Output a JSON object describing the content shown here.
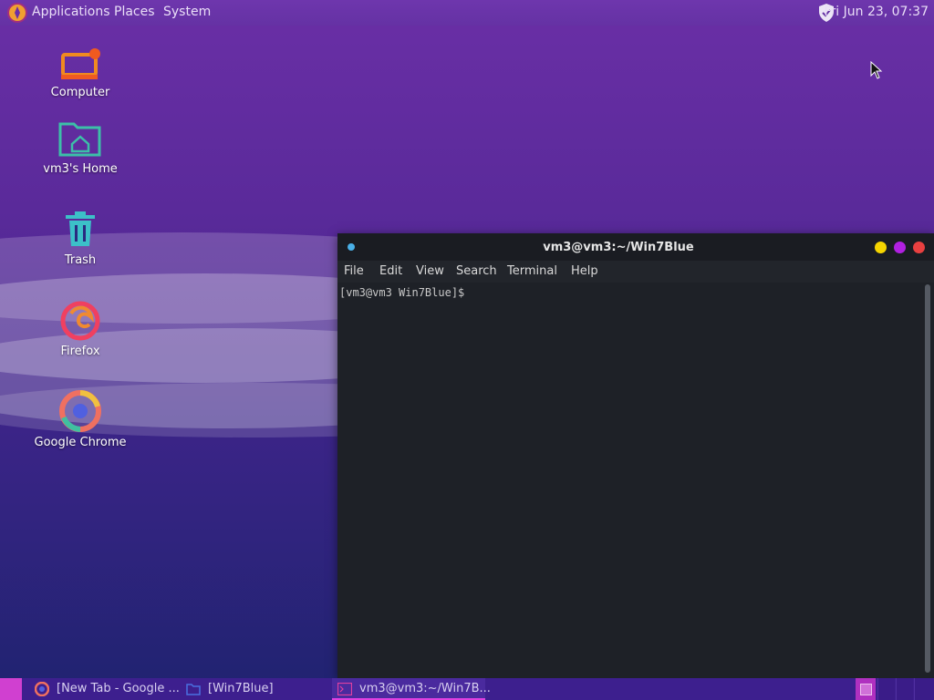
{
  "top_panel": {
    "applications_label": "Applications",
    "places_label": "Places",
    "system_label": "System",
    "clock": "Fri Jun 23, 07:37"
  },
  "desktop_icons": [
    {
      "label": "Computer",
      "icon": "computer-icon"
    },
    {
      "label": "vm3's Home",
      "icon": "home-folder-icon"
    },
    {
      "label": "Trash",
      "icon": "trash-icon"
    },
    {
      "label": "Firefox",
      "icon": "firefox-icon"
    },
    {
      "label": "Google Chrome",
      "icon": "chrome-icon"
    }
  ],
  "terminal": {
    "title": "vm3@vm3:~/Win7Blue",
    "menu": [
      "File",
      "Edit",
      "View",
      "Search",
      "Terminal",
      "Help"
    ],
    "prompt": "[vm3@vm3 Win7Blue]$"
  },
  "taskbar": {
    "tasks": [
      {
        "label": "[New Tab - Google ...",
        "icon": "chrome-icon"
      },
      {
        "label": "[Win7Blue]",
        "icon": "folder-icon"
      },
      {
        "label": "vm3@vm3:~/Win7B...",
        "icon": "terminal-icon"
      }
    ]
  },
  "colors": {
    "accent": "#e040e0",
    "close": "#e84040",
    "minimize": "#f5d400",
    "maximize": "#b020e0"
  }
}
